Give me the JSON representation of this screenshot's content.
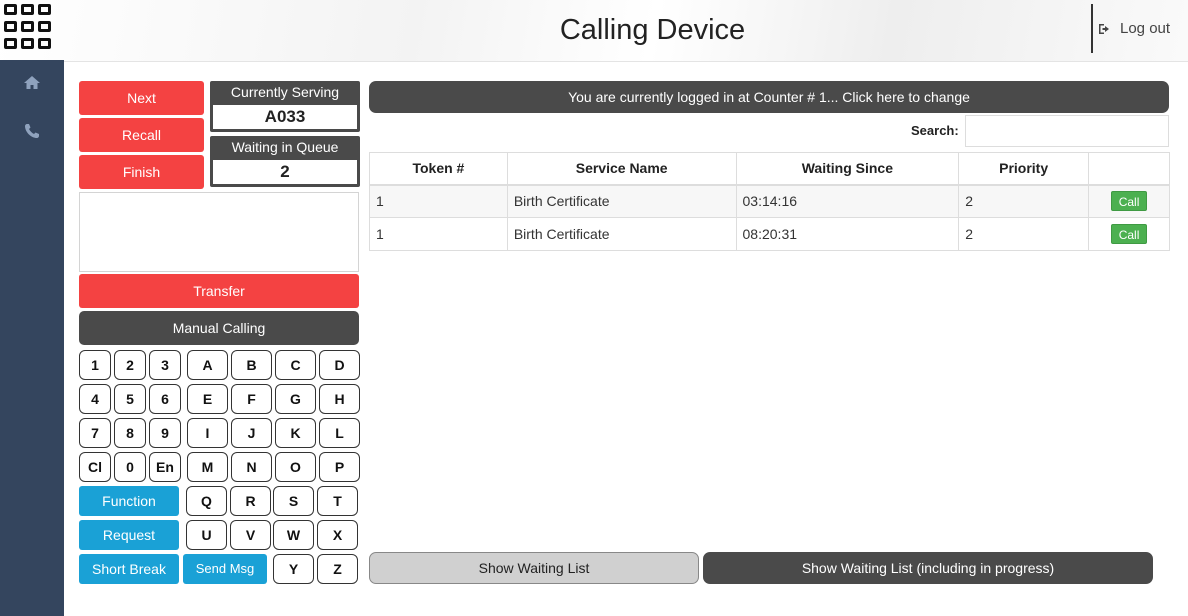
{
  "header": {
    "title": "Calling Device",
    "logout_label": "Log out"
  },
  "sidebar": {
    "items": [
      {
        "icon": "home-icon"
      },
      {
        "icon": "phone-icon"
      }
    ]
  },
  "controls": {
    "next": "Next",
    "recall": "Recall",
    "finish": "Finish",
    "currently_serving_label": "Currently Serving",
    "currently_serving_value": "A033",
    "waiting_label": "Waiting in Queue",
    "waiting_value": "2",
    "notes_value": "",
    "transfer": "Transfer",
    "manual_calling": "Manual Calling"
  },
  "keypad": {
    "digits": [
      "1",
      "2",
      "3",
      "4",
      "5",
      "6",
      "7",
      "8",
      "9",
      "Cl",
      "0",
      "En"
    ],
    "letters": [
      "A",
      "B",
      "C",
      "D",
      "E",
      "F",
      "G",
      "H",
      "I",
      "J",
      "K",
      "L",
      "M",
      "N",
      "O",
      "P",
      "Q",
      "R",
      "S",
      "T",
      "U",
      "V",
      "W",
      "X",
      "Y",
      "Z"
    ],
    "function": "Function",
    "request": "Request",
    "short_break": "Short Break",
    "send_msg": "Send Msg"
  },
  "main": {
    "counter_notice": "You are currently logged in at Counter # 1... Click here to change",
    "search_label": "Search:",
    "search_value": "",
    "columns": [
      "Token #",
      "Service Name",
      "Waiting Since",
      "Priority",
      ""
    ],
    "rows": [
      {
        "token": "1",
        "service": "Birth Certificate",
        "since": "03:14:16",
        "priority": "2",
        "action": "Call"
      },
      {
        "token": "1",
        "service": "Birth Certificate",
        "since": "08:20:31",
        "priority": "2",
        "action": "Call"
      }
    ],
    "show_waiting_list": "Show Waiting List",
    "show_waiting_list_progress": "Show Waiting List (including in progress)"
  },
  "colors": {
    "sidebar": "#34455e",
    "red": "#f44242",
    "dark": "#4a4a4a",
    "blue": "#1aa1d6",
    "green": "#4cb050"
  }
}
